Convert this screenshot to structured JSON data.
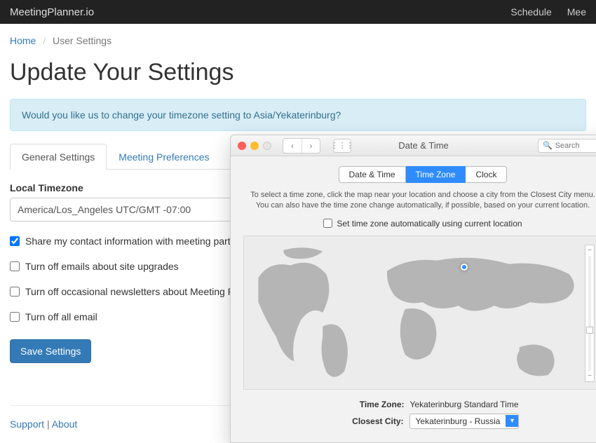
{
  "navbar": {
    "brand": "MeetingPlanner.io",
    "links": [
      "Schedule",
      "Mee"
    ]
  },
  "breadcrumb": {
    "home": "Home",
    "current": "User Settings"
  },
  "page_title": "Update Your Settings",
  "alert": "Would you like us to change your timezone setting to Asia/Yekaterinburg?",
  "tabs": {
    "general": "General Settings",
    "meeting": "Meeting Preferences"
  },
  "form": {
    "tz_label": "Local Timezone",
    "tz_value": "America/Los_Angeles UTC/GMT -07:00",
    "share_contact": "Share my contact information with meeting participants",
    "turn_off_upgrades": "Turn off emails about site upgrades",
    "turn_off_newsletters": "Turn off occasional newsletters about Meeting Planner",
    "turn_off_all": "Turn off all email",
    "save": "Save Settings"
  },
  "footer": {
    "support": "Support",
    "about": "About"
  },
  "mac": {
    "title": "Date & Time",
    "search_placeholder": "Search",
    "seg": {
      "date": "Date & Time",
      "tz": "Time Zone",
      "clock": "Clock"
    },
    "info1": "To select a time zone, click the map near your location and choose a city from the Closest City menu.",
    "info2": "You can also have the time zone change automatically, if possible, based on your current location.",
    "auto_label": "Set time zone automatically using current location",
    "tz_label": "Time Zone:",
    "tz_value": "Yekaterinburg Standard Time",
    "city_label": "Closest City:",
    "city_value": "Yekaterinburg - Russia"
  }
}
